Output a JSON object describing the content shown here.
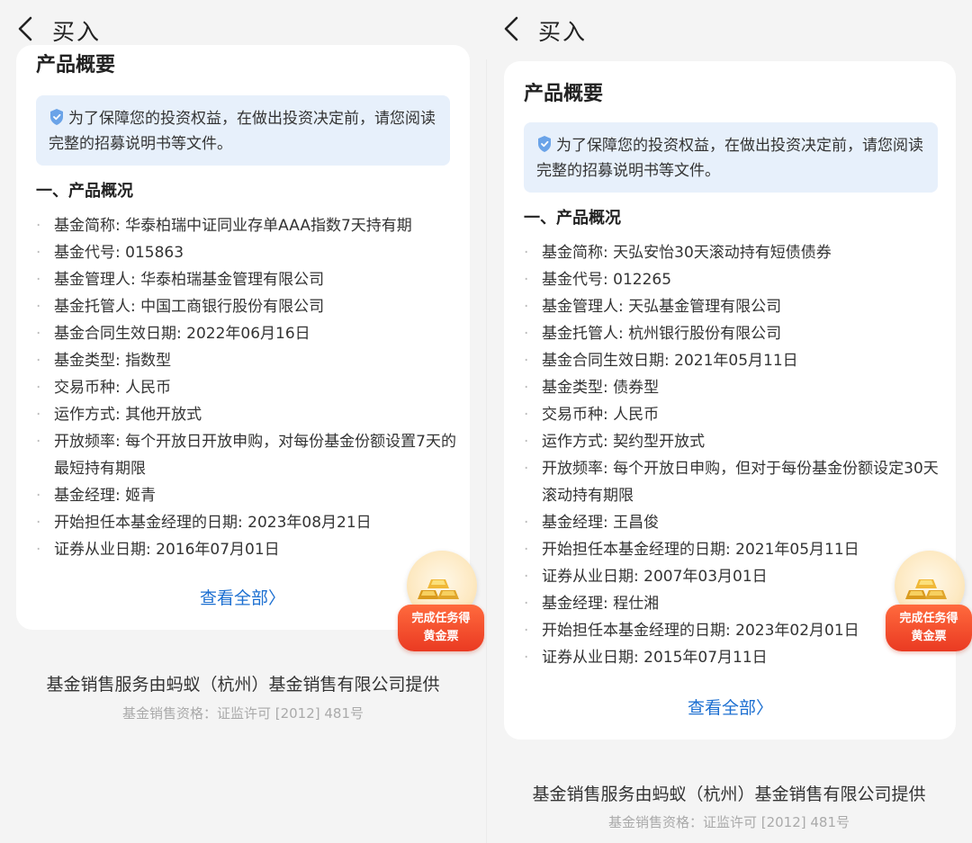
{
  "left": {
    "topbar": {
      "title": "买入"
    },
    "card_title": "产品概要",
    "notice": "为了保障您的投资权益，在做出投资决定前，请您阅读完整的招募说明书等文件。",
    "section_title": "一、产品概况",
    "info": [
      "基金简称: 华泰柏瑞中证同业存单AAA指数7天持有期",
      "基金代号: 015863",
      "基金管理人: 华泰柏瑞基金管理有限公司",
      "基金托管人: 中国工商银行股份有限公司",
      "基金合同生效日期: 2022年06月16日",
      "基金类型: 指数型",
      "交易币种: 人民币",
      "运作方式: 其他开放式",
      "开放频率: 每个开放日开放申购，对每份基金份额设置7天的最短持有期限",
      "基金经理: 姬青",
      "开始担任本基金经理的日期: 2023年08月21日",
      "证券从业日期: 2016年07月01日"
    ],
    "view_all": "查看全部〉",
    "badge": {
      "line1": "完成任务得",
      "line2": "黄金票"
    },
    "footer_main": "基金销售服务由蚂蚁（杭州）基金销售有限公司提供",
    "footer_sub": "基金销售资格：证监许可 [2012] 481号"
  },
  "right": {
    "topbar": {
      "title": "买入"
    },
    "card_title": "产品概要",
    "notice": "为了保障您的投资权益，在做出投资决定前，请您阅读完整的招募说明书等文件。",
    "section_title": "一、产品概况",
    "info": [
      "基金简称: 天弘安怡30天滚动持有短债债券",
      "基金代号: 012265",
      "基金管理人: 天弘基金管理有限公司",
      "基金托管人: 杭州银行股份有限公司",
      "基金合同生效日期: 2021年05月11日",
      "基金类型: 债券型",
      "交易币种: 人民币",
      "运作方式: 契约型开放式",
      "开放频率: 每个开放日申购，但对于每份基金份额设定30天滚动持有期限",
      "基金经理: 王昌俊",
      "开始担任本基金经理的日期: 2021年05月11日",
      "证券从业日期: 2007年03月01日",
      "基金经理: 程仕湘",
      "开始担任本基金经理的日期: 2023年02月01日",
      "证券从业日期: 2015年07月11日"
    ],
    "view_all": "查看全部〉",
    "badge": {
      "line1": "完成任务得",
      "line2": "黄金票"
    },
    "footer_main": "基金销售服务由蚂蚁（杭州）基金销售有限公司提供",
    "footer_sub": "基金销售资格：证监许可 [2012] 481号"
  },
  "colors": {
    "accent_link": "#1c6fd1",
    "notice_bg": "#e7f0fb",
    "badge_red": "#ea3a22"
  },
  "icons": [
    "back-arrow-icon",
    "shield-icon",
    "gold-bars-icon"
  ]
}
